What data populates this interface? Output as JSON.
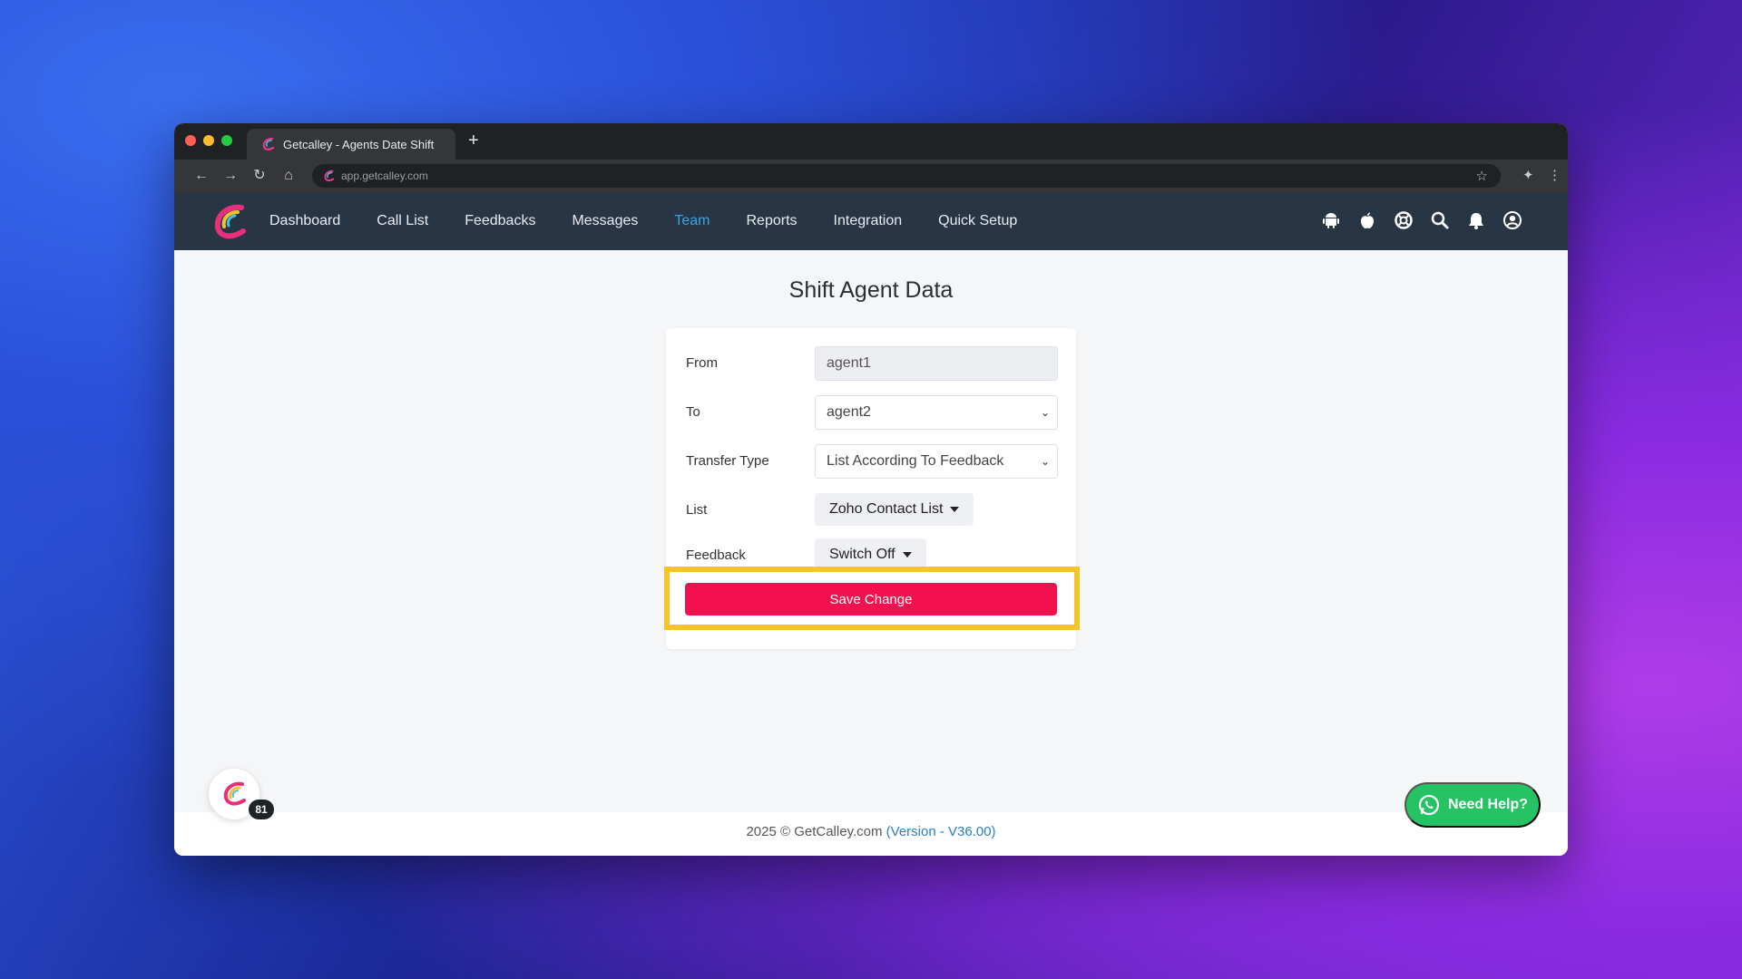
{
  "browser": {
    "tab_title": "Getcalley - Agents Date Shift",
    "new_tab_symbol": "+",
    "url": "app.getcalley.com"
  },
  "nav": {
    "items": [
      {
        "label": "Dashboard",
        "active": false
      },
      {
        "label": "Call List",
        "active": false
      },
      {
        "label": "Feedbacks",
        "active": false
      },
      {
        "label": "Messages",
        "active": false
      },
      {
        "label": "Team",
        "active": true
      },
      {
        "label": "Reports",
        "active": false
      },
      {
        "label": "Integration",
        "active": false
      },
      {
        "label": "Quick Setup",
        "active": false
      }
    ],
    "icons": [
      "android-icon",
      "apple-icon",
      "support-icon",
      "search-icon",
      "bell-icon",
      "user-icon"
    ],
    "active_color": "#3aa3e6"
  },
  "page": {
    "title": "Shift Agent Data"
  },
  "form": {
    "from_label": "From",
    "from_value": "agent1",
    "to_label": "To",
    "to_value": "agent2",
    "transfer_type_label": "Transfer Type",
    "transfer_type_value": "List According To Feedback",
    "list_label": "List",
    "list_value": "Zoho Contact List",
    "feedback_label": "Feedback",
    "feedback_value": "Switch Off",
    "save_label": "Save Change"
  },
  "footer": {
    "copyright": "2025 © GetCalley.com ",
    "version": "(Version - V36.00)"
  },
  "widget": {
    "badge_count": "81"
  },
  "help": {
    "label": "Need Help?"
  },
  "colors": {
    "nav_bg": "#283544",
    "save_button": "#f5104f",
    "highlight": "#f7c52b",
    "help_button": "#25c363"
  }
}
